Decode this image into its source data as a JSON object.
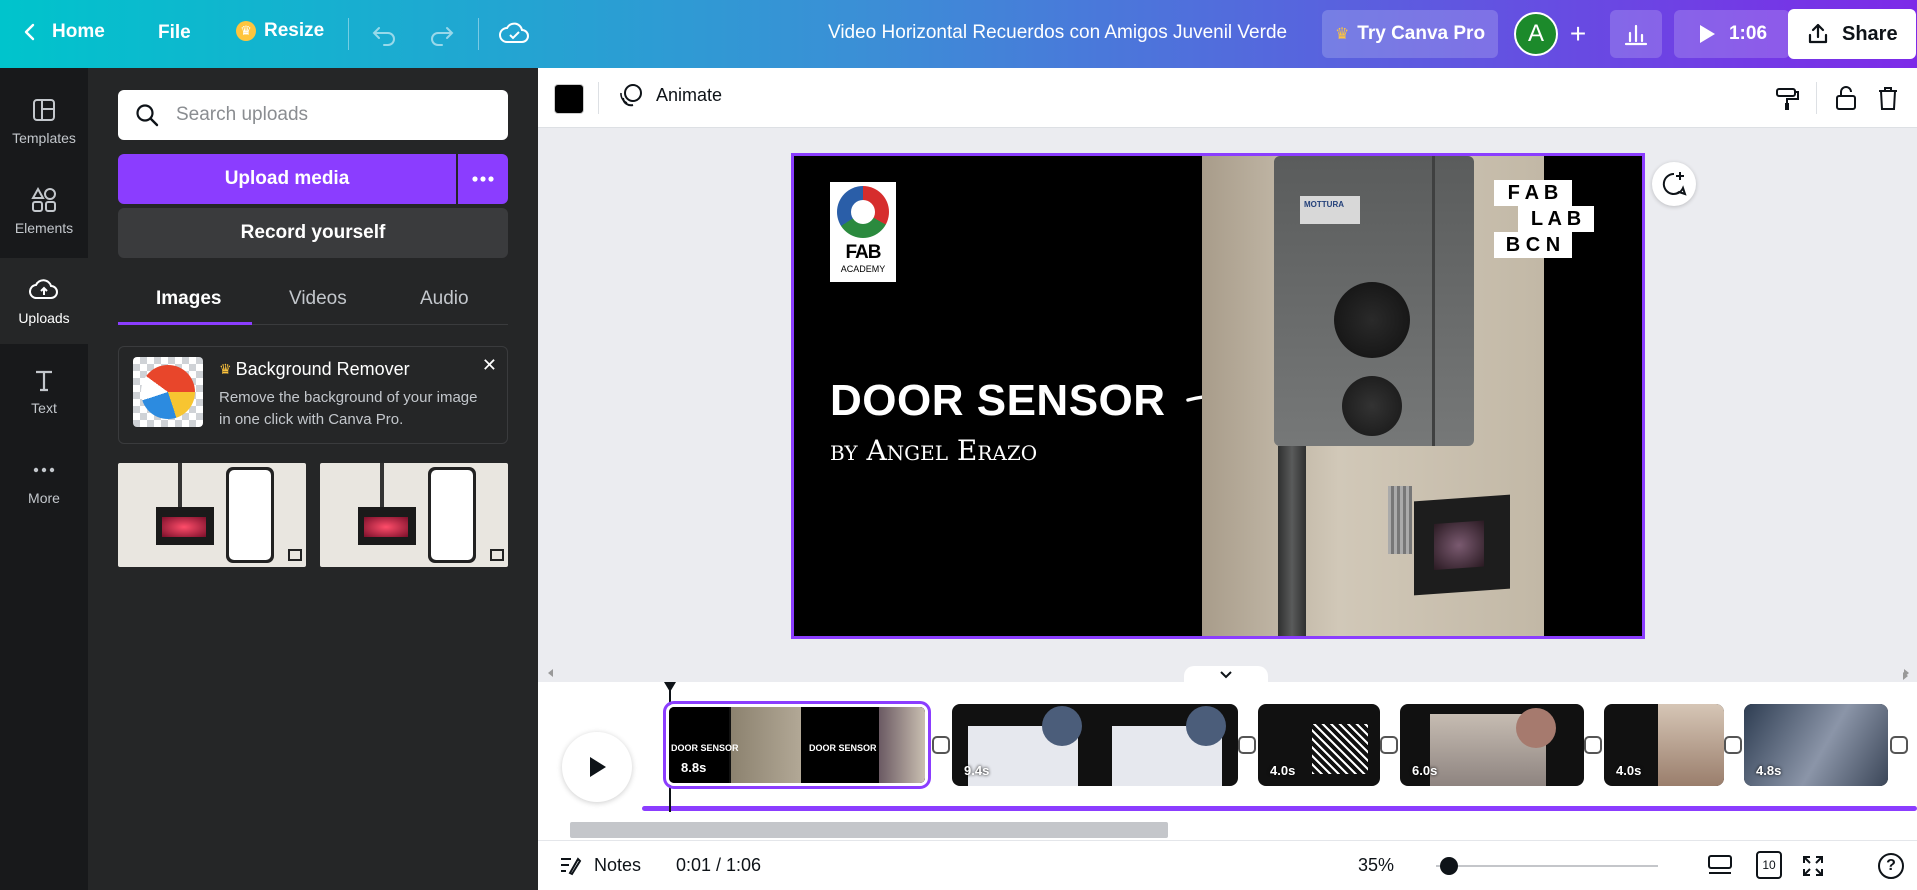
{
  "topbar": {
    "home": "Home",
    "file": "File",
    "resize": "Resize",
    "doc_title": "Video Horizontal Recuerdos con Amigos Juvenil Verde",
    "try_pro": "Try Canva Pro",
    "avatar_initial": "A",
    "play_time": "1:06",
    "share": "Share"
  },
  "rail": {
    "items": [
      {
        "label": "Templates",
        "icon": "templates-icon"
      },
      {
        "label": "Elements",
        "icon": "elements-icon"
      },
      {
        "label": "Uploads",
        "icon": "uploads-icon"
      },
      {
        "label": "Text",
        "icon": "text-icon"
      },
      {
        "label": "More",
        "icon": "more-icon"
      }
    ]
  },
  "panel": {
    "search_placeholder": "Search uploads",
    "upload_media": "Upload media",
    "record_yourself": "Record yourself",
    "tabs": [
      "Images",
      "Videos",
      "Audio"
    ],
    "promo": {
      "title": "Background Remover",
      "body": "Remove the background of your image in one click with Canva Pro."
    }
  },
  "toolbar": {
    "animate": "Animate",
    "color": "#000000"
  },
  "slide": {
    "title": "DOOR SENSOR",
    "byline": "by Angel Erazo",
    "fab_logo": "FAB",
    "fab_logo_sub": "ACADEMY",
    "fablab_lines": [
      "F A B",
      "L A B",
      "B C N"
    ],
    "device_brand": "MOTTURA"
  },
  "timeline": {
    "clips": [
      {
        "duration": "8.8s",
        "thumb_title": "DOOR SENSOR"
      },
      {
        "duration": "9.4s"
      },
      {
        "duration": "4.0s"
      },
      {
        "duration": "6.0s"
      },
      {
        "duration": "4.0s"
      },
      {
        "duration": "4.8s"
      }
    ]
  },
  "bottombar": {
    "notes": "Notes",
    "time": "0:01 / 1:06",
    "zoom": "35%",
    "pages": "10"
  },
  "colors": {
    "accent": "#8b3dff",
    "rail_bg": "#18191b",
    "panel_bg": "#252627"
  }
}
